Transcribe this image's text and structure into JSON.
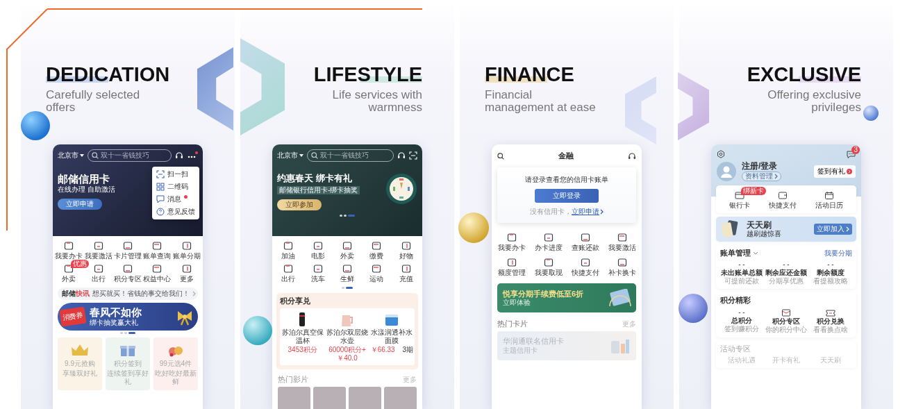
{
  "panels": [
    {
      "kind": "home",
      "title": "DEDICATION",
      "subtitle": "Carefully selected offers",
      "color": "#c7d4f2",
      "phone": {
        "city": "北京市",
        "search": {
          "placeholder": "双十一省钱技巧"
        },
        "more_alert": true,
        "banner": {
          "title": "邮储信用卡",
          "subtitle": "在线办理 自助激活",
          "button": "立即申请"
        },
        "menu": [
          {
            "label": "扫一扫",
            "dot": false
          },
          {
            "label": "二维码",
            "dot": false
          },
          {
            "label": "消息",
            "dot": true
          },
          {
            "label": "意见反馈",
            "dot": false
          }
        ],
        "shortcuts": [
          {
            "label": "我要办卡"
          },
          {
            "label": "我要激活"
          },
          {
            "label": "卡片管理"
          },
          {
            "label": "账单查询"
          },
          {
            "label": "账单分期"
          },
          {
            "label": "外卖",
            "badge": "优惠"
          },
          {
            "label": "出行"
          },
          {
            "label": "积分专区"
          },
          {
            "label": "权益中心"
          },
          {
            "label": "更多"
          }
        ],
        "news": {
          "brand": "邮储",
          "tag": "快讯",
          "text": "想买就买！省钱的事交给我们！"
        },
        "promo": {
          "title": "春风不如你",
          "subtitle": "绑卡抽奖赢大礼",
          "badge": "消费券"
        },
        "dots": [
          {
            "selected": false
          },
          {
            "selected": false
          },
          {
            "selected": true
          }
        ],
        "offers": [
          {
            "title": "9.9元抢购",
            "subtitle": "享臻双好礼"
          },
          {
            "title": "积分签到",
            "subtitle": "连续签到享好礼"
          },
          {
            "title": "99元选4件",
            "subtitle": "吃好吃好最新鲜"
          }
        ]
      }
    },
    {
      "kind": "life",
      "title": "LIFESTYLE",
      "subtitle": "Life services with warmness",
      "color": "#cfe9e2",
      "phone": {
        "city": "北京市",
        "search": {
          "placeholder": "双十一省钱技巧"
        },
        "banner": {
          "title": "约惠春天 绑卡有礼",
          "subtitle": "邮储银行信用卡-绑卡抽奖",
          "button": "立即参加"
        },
        "banner_dots": [
          {
            "selected": false
          },
          {
            "selected": false
          },
          {
            "selected": true
          }
        ],
        "shortcuts": [
          {
            "label": "加油"
          },
          {
            "label": "电影"
          },
          {
            "label": "外卖"
          },
          {
            "label": "缴费"
          },
          {
            "label": "好物"
          },
          {
            "label": "出行"
          },
          {
            "label": "洗车"
          },
          {
            "label": "生鲜"
          },
          {
            "label": "运动"
          },
          {
            "label": "充值"
          }
        ],
        "dots": [
          {
            "selected": false
          },
          {
            "selected": true
          }
        ],
        "points": {
          "title": "积分享兑",
          "items": [
            {
              "name": "苏泊尔真空保温杯",
              "price": "3453积分"
            },
            {
              "name": "苏泊尔双层烧水壶",
              "price": "60000积分+￥40.0"
            },
            {
              "name": "水漾润透补水面膜",
              "price": "￥66.33",
              "note": "3期"
            }
          ]
        },
        "movies": {
          "title": "热门影片",
          "more": "更多"
        }
      }
    },
    {
      "kind": "finance",
      "title": "FINANCE",
      "subtitle": "Financial management at ease",
      "color": "#efe0bf",
      "phone": {
        "title": "金融",
        "login": {
          "prompt": "请登录查看您的信用卡账单",
          "button": "立即登录",
          "hint": "没有信用卡，",
          "link": "立即申请"
        },
        "shortcuts": [
          {
            "label": "我要办卡"
          },
          {
            "label": "办卡进度"
          },
          {
            "label": "查账还款"
          },
          {
            "label": "我要激活"
          },
          {
            "label": "额度管理"
          },
          {
            "label": "我要取现"
          },
          {
            "label": "快捷支付"
          },
          {
            "label": "补卡换卡"
          }
        ],
        "promo": {
          "title": "悦享分期手续费低至6折",
          "button": "立即体验"
        },
        "cards": {
          "title": "热门卡片",
          "more": "更多",
          "name": "华润通联名信用卡",
          "subtitle": "主题信用卡"
        }
      }
    },
    {
      "kind": "mine",
      "title": "EXCLUSIVE",
      "subtitle": "Offering exclusive privileges",
      "color": "#e6d8f0",
      "phone": {
        "message_badge": "3",
        "user": "注册/登录",
        "profile": "资料管理",
        "checkin": "签到有礼",
        "quick": [
          {
            "label": "银行卡",
            "badge": "绑新卡"
          },
          {
            "label": "快捷支付"
          },
          {
            "label": "活动日历"
          }
        ],
        "promo": {
          "title": "天天刷",
          "subtitle": "越刷越惊喜",
          "button": "立即加入"
        },
        "bill": {
          "title": "账单管理",
          "action": "我要分期",
          "stats": [
            {
              "value": "- -",
              "label": "未出账单总额",
              "hint": "可提前还款"
            },
            {
              "value": "- -",
              "label": "剩余应还金额",
              "hint": "分期享优惠"
            },
            {
              "value": "- -",
              "label": "剩余额度",
              "hint": "看提额攻略"
            }
          ]
        },
        "points": {
          "title": "积分精彩",
          "items": [
            {
              "kind": "value",
              "value": "- -",
              "label": "总积分",
              "hint": "签到赚积分"
            },
            {
              "kind": "icon",
              "label": "积分专区",
              "hint": "你的积分中心"
            },
            {
              "kind": "icon",
              "label": "积分兑换",
              "hint": "看看换点啥"
            }
          ]
        },
        "activity": {
          "title": "活动专区",
          "items": [
            "活动礼遇",
            "开卡有礼",
            "天天刷"
          ]
        }
      }
    }
  ]
}
